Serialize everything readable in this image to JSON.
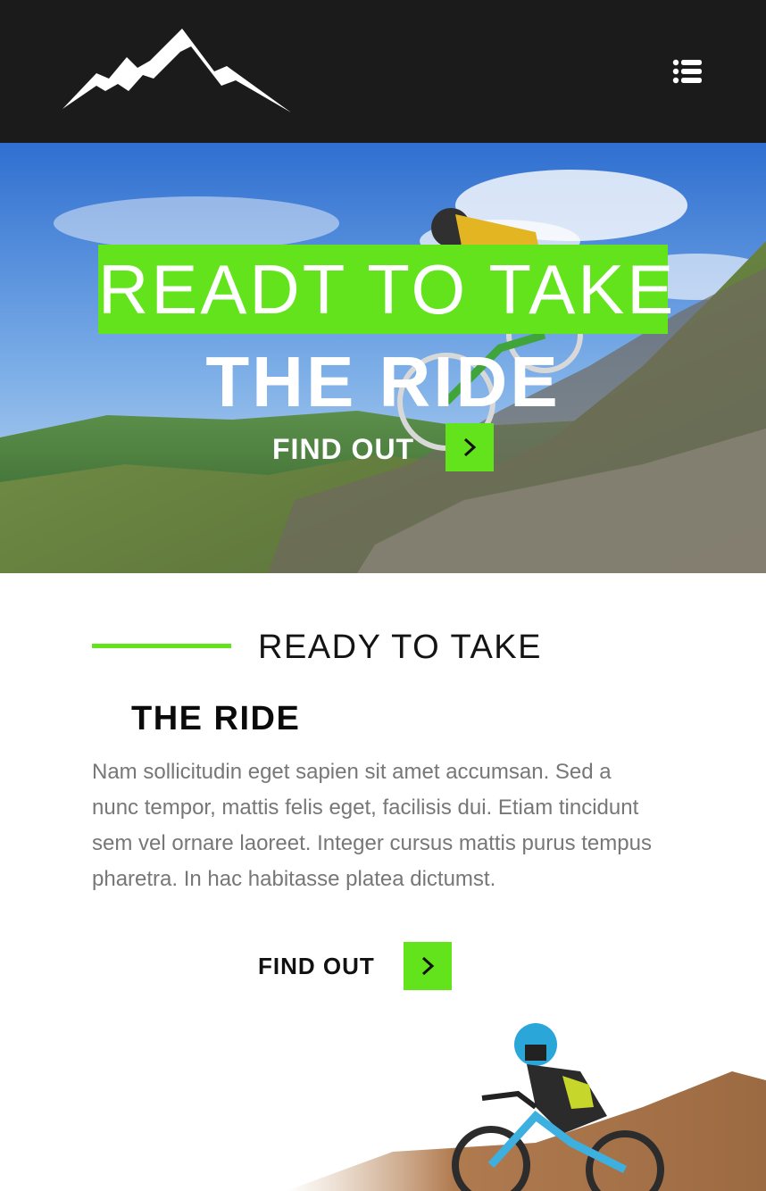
{
  "header": {
    "logo": "mountain-logo",
    "menu_icon": "list-menu-icon"
  },
  "hero": {
    "headline_line1": "READT TO TAKE",
    "headline_line2": "THE RIDE",
    "cta_label": "FIND OUT",
    "cta_icon": "chevron-right-icon",
    "background": "mountain-biker-hero-photo"
  },
  "section": {
    "title": "READY TO TAKE",
    "subtitle": "THE RIDE",
    "body": "Nam sollicitudin eget sapien sit amet accumsan. Sed a nunc tempor, mattis felis eget, facilisis dui. Etiam tincidunt sem vel ornare laoreet. Integer cursus mattis purus tempus pharetra. In hac habitasse platea dictumst.",
    "cta_label": "FIND OUT",
    "cta_icon": "chevron-right-icon",
    "image": "downhill-rider-photo"
  },
  "colors": {
    "accent": "#63e31c",
    "header_bg": "#1b1b1b",
    "body_text": "#777777"
  }
}
